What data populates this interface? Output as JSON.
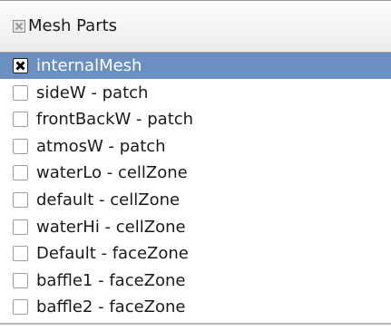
{
  "header": {
    "title": "Mesh Parts",
    "checkbox_icon": "partial-check-icon"
  },
  "rows": [
    {
      "label": "internalMesh",
      "checked": true,
      "selected": true
    },
    {
      "label": "sideW - patch",
      "checked": false,
      "selected": false
    },
    {
      "label": "frontBackW - patch",
      "checked": false,
      "selected": false
    },
    {
      "label": "atmosW - patch",
      "checked": false,
      "selected": false
    },
    {
      "label": "waterLo - cellZone",
      "checked": false,
      "selected": false
    },
    {
      "label": "default - cellZone",
      "checked": false,
      "selected": false
    },
    {
      "label": "waterHi - cellZone",
      "checked": false,
      "selected": false
    },
    {
      "label": "Default - faceZone",
      "checked": false,
      "selected": false
    },
    {
      "label": "baffle1 - faceZone",
      "checked": false,
      "selected": false
    },
    {
      "label": "baffle2 - faceZone",
      "checked": false,
      "selected": false
    }
  ],
  "colors": {
    "selection": "#6b8fc0",
    "header_bg": "#f0f0f0"
  }
}
